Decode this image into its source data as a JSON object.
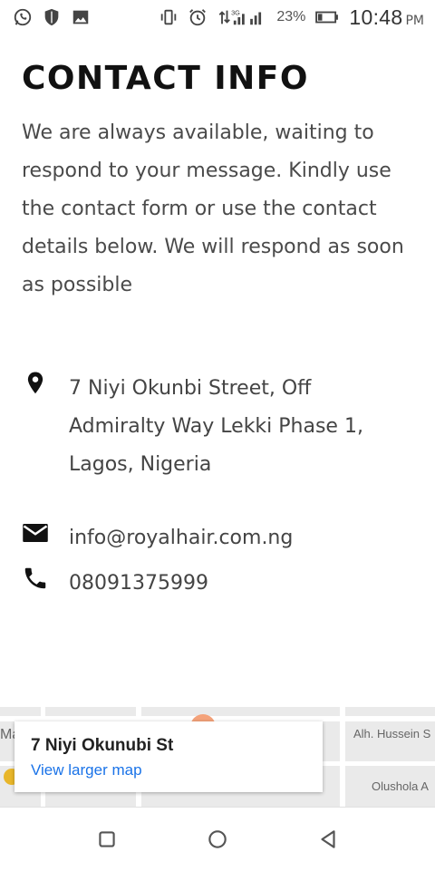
{
  "status_bar": {
    "battery_percent": "23%",
    "time": "10:48",
    "ampm": "PM",
    "network_label": "3G",
    "icons": [
      "whatsapp-icon",
      "shield-icon",
      "image-icon",
      "vibrate-icon",
      "alarm-icon",
      "data-arrows-icon",
      "signal-icon",
      "battery-icon"
    ]
  },
  "page": {
    "title": "CONTACT INFO",
    "intro": "We are always available, waiting to respond to your message. Kindly use the contact form or use the contact details below. We will respond as soon as possible"
  },
  "contact": {
    "address": "7 Niyi Okunbi Street, Off Admiralty Way Lekki Phase 1, Lagos, Nigeria",
    "email": "info@royalhair.com.ng",
    "phone": "08091375999"
  },
  "map": {
    "place_title": "7 Niyi Okunubi St",
    "larger_map_link": "View larger map",
    "street_labels": [
      "Alh. Hussein S",
      "Olushola A",
      "Ma"
    ]
  },
  "nav_bar": {
    "buttons": [
      "recents-button",
      "home-button",
      "back-button"
    ]
  }
}
